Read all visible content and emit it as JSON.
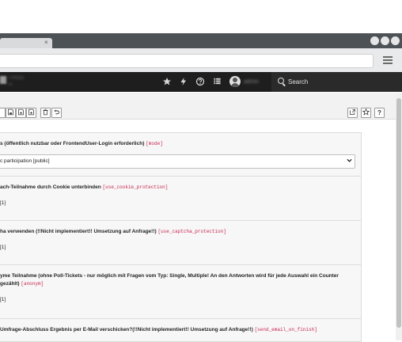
{
  "browser": {
    "tab_close": "×",
    "menu_icon": "hamburger-menu-icon"
  },
  "topbar": {
    "logo_line1": "TYPO3",
    "logo_line2": "v9",
    "icons": [
      "star-icon",
      "bolt-icon",
      "help-icon",
      "list-icon"
    ],
    "username": "admin",
    "search_label": "Search"
  },
  "doc_toolbar": {
    "left_buttons": [
      "close-doc-icon",
      "save-icon",
      "save-view-icon",
      "save-new-icon",
      "delete-icon",
      "undo-icon"
    ],
    "right_buttons": [
      "open-new-window-icon",
      "bookmark-icon",
      "help-icon"
    ],
    "help_label": "?"
  },
  "form": {
    "mode": {
      "label": "s (öffentlich nutzbar oder FrontendUser-Login erforderlich)",
      "field": "[mode]",
      "selected": "c participation [public]"
    },
    "cookie": {
      "label": "ach-Teilnahme durch Cookie unterbinden",
      "field": "[use_cookie_protection]",
      "value": "[1]"
    },
    "captcha": {
      "label": "ha verwenden (!!Nicht implementiert!! Umsetzung auf Anfrage!!)",
      "field": "[use_captcha_protection]",
      "value": "[1]"
    },
    "anonym": {
      "label_line1": "yme Teilnahme (ohne Poll-Tickets - nur möglich mit Fragen vom Typ: Single, Multiple! An den Antworten wird für jede Auswahl ein Counter",
      "label_line2": "gezählt)",
      "field": "[anonym]",
      "value": "[1]"
    },
    "email": {
      "label": "Umfrage-Abschluss Ergebnis per E-Mail verschicken?(!!Nicht implementiert!! Umsetzung auf Anfrage!!)",
      "field": "[send_email_on_finish]"
    }
  }
}
